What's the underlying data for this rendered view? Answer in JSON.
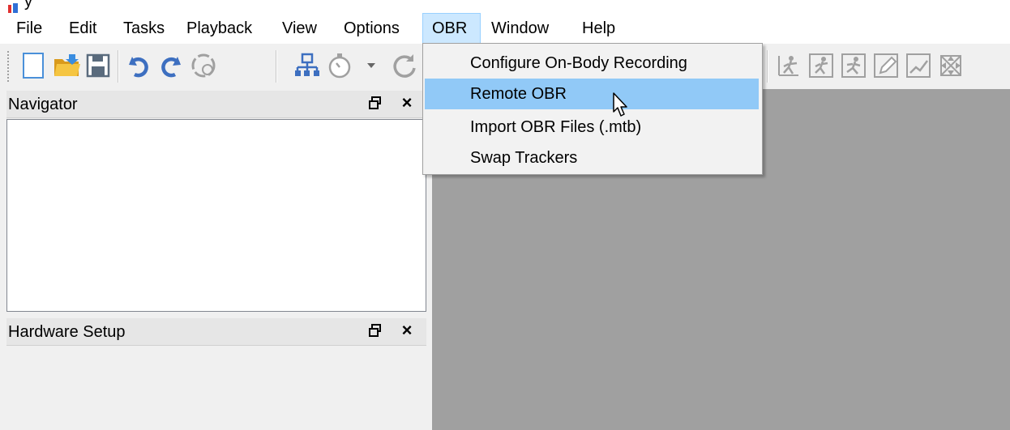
{
  "window": {
    "title": "y"
  },
  "menubar": {
    "items": [
      {
        "label": "File"
      },
      {
        "label": "Edit"
      },
      {
        "label": "Tasks"
      },
      {
        "label": "Playback"
      },
      {
        "label": "View"
      },
      {
        "label": "Options"
      },
      {
        "label": "OBR"
      },
      {
        "label": "Window"
      },
      {
        "label": "Help"
      }
    ],
    "open_menu": "OBR"
  },
  "toolbar": {
    "left_icons": [
      "new-file-icon",
      "open-folder-icon",
      "save-icon",
      "undo-icon",
      "redo-icon",
      "reset-icon",
      "network-icon",
      "stopwatch-icon",
      "dropdown-arrow-icon",
      "refresh-icon"
    ],
    "right_icons": [
      "skeleton-icon",
      "runner-icon",
      "motion-icon",
      "pencil-icon",
      "graph-icon",
      "expand-icon"
    ]
  },
  "navigator": {
    "title": "Navigator"
  },
  "hardware_setup": {
    "title": "Hardware Setup"
  },
  "obr_menu": {
    "items": [
      {
        "label": "Configure On-Body Recording"
      },
      {
        "label": "Remote OBR",
        "highlighted": true
      },
      {
        "label": "Import OBR Files (.mtb)"
      },
      {
        "label": "Swap Trackers"
      }
    ]
  },
  "colors": {
    "menu_open_bg": "#cce8ff",
    "menu_highlight": "#91c9f7",
    "central_bg": "#a0a0a0",
    "panel_title_bg": "#e6e6e6"
  }
}
